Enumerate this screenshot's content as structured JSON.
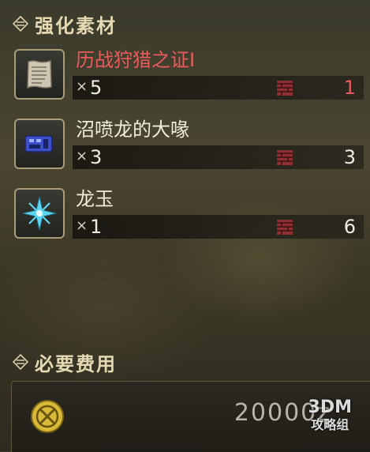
{
  "materials_section": {
    "title": "强化素材"
  },
  "materials": [
    {
      "name": "历战狩猎之证Ⅰ",
      "qty_prefix": "×",
      "qty": "5",
      "owned": "1",
      "name_color": "#ea5a5c",
      "owned_color": "#ea5a5c",
      "icon": "parchment-icon"
    },
    {
      "name": "沼喷龙的大喙",
      "qty_prefix": "×",
      "qty": "3",
      "owned": "3",
      "name_color": "#f1ece0",
      "owned_color": "#f1ece0",
      "icon": "beak-icon"
    },
    {
      "name": "龙玉",
      "qty_prefix": "×",
      "qty": "1",
      "owned": "6",
      "name_color": "#f1ece0",
      "owned_color": "#f1ece0",
      "icon": "dragon-gem-icon"
    }
  ],
  "cost_section": {
    "title": "必要费用",
    "value": "20000z"
  },
  "watermark": {
    "line1": "3DM",
    "line2": "攻略组"
  }
}
